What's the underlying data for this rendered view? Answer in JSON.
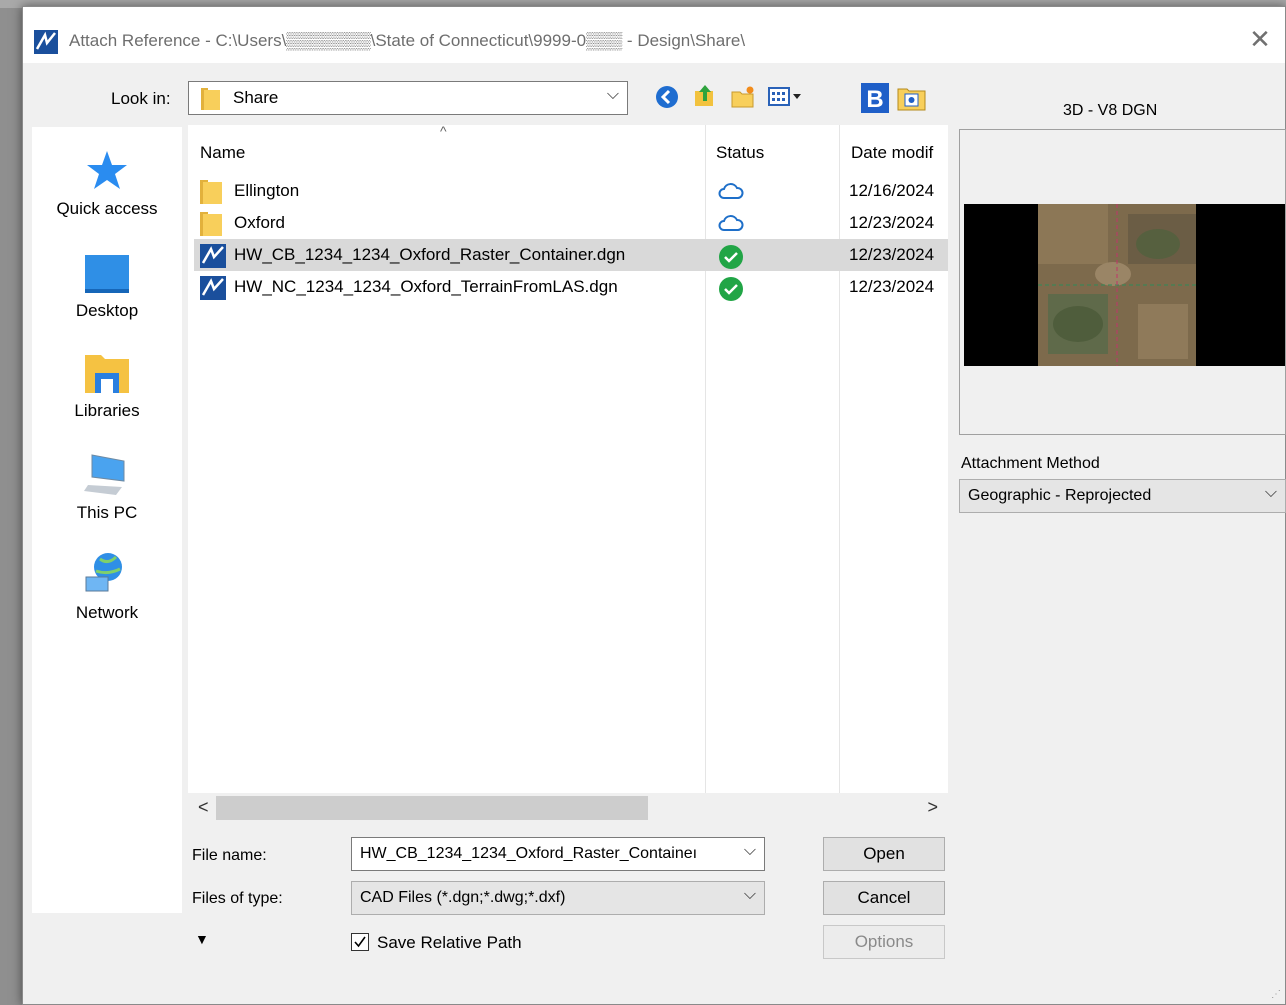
{
  "window": {
    "title": "Attach Reference - C:\\Users\\▒▒▒▒▒▒▒\\State of Connecticut\\9999-0▒▒▒ - Design\\Share\\",
    "close_glyph": "✕"
  },
  "toolbar": {
    "look_in_label": "Look in:",
    "look_in_value": "Share",
    "dropdown_glyph": "⌵",
    "icons": [
      "back-icon",
      "up-folder-icon",
      "new-folder-icon",
      "view-menu-icon",
      "bentley-icon",
      "bookmark-folder-icon"
    ]
  },
  "places": [
    {
      "label": "Quick access",
      "icon": "star-icon"
    },
    {
      "label": "Desktop",
      "icon": "desktop-icon"
    },
    {
      "label": "Libraries",
      "icon": "libraries-icon"
    },
    {
      "label": "This PC",
      "icon": "computer-icon"
    },
    {
      "label": "Network",
      "icon": "network-icon"
    }
  ],
  "file_list": {
    "columns": [
      "Name",
      "Status",
      "Date modif"
    ],
    "sort_glyph": "^",
    "rows": [
      {
        "name": "Ellington",
        "type": "folder",
        "status": "cloud",
        "date": "12/16/2024"
      },
      {
        "name": "Oxford",
        "type": "folder",
        "status": "cloud",
        "date": "12/23/2024"
      },
      {
        "name": "HW_CB_1234_1234_Oxford_Raster_Container.dgn",
        "type": "dgn",
        "status": "synced",
        "date": "12/23/2024",
        "selected": true
      },
      {
        "name": "HW_NC_1234_1234_Oxford_TerrainFromLAS.dgn",
        "type": "dgn",
        "status": "synced",
        "date": "12/23/2024"
      }
    ],
    "scroll_left": "<",
    "scroll_right": ">"
  },
  "form": {
    "file_name_label": "File name:",
    "file_name_value": "HW_CB_1234_1234_Oxford_Raster_Containeı",
    "files_of_type_label": "Files of type:",
    "files_of_type_value": "CAD Files (*.dgn;*.dwg;*.dxf)",
    "save_relative_path_label": "Save Relative Path",
    "save_relative_path_checked": true,
    "expander_glyph": "▼"
  },
  "buttons": {
    "open": "Open",
    "cancel": "Cancel",
    "options": "Options"
  },
  "preview": {
    "title": "3D - V8 DGN",
    "attachment_method_label": "Attachment Method",
    "attachment_method_value": "Geographic - Reprojected"
  },
  "colors": {
    "selected_row": "#d9d9d9",
    "synced_green": "#21a546",
    "cloud_blue": "#1e6fc9",
    "folder_yellow": "#f8cf5b"
  }
}
